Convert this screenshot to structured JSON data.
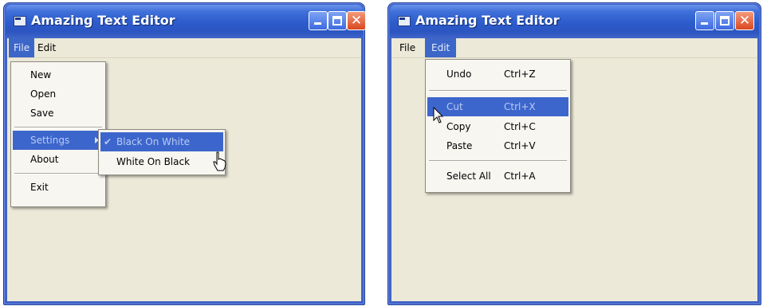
{
  "left_window": {
    "title": "Amazing Text Editor",
    "menubar": {
      "file": "File",
      "edit": "Edit"
    },
    "file_menu": {
      "items": [
        "New",
        "Open",
        "Save",
        "Settings",
        "About",
        "Exit"
      ],
      "highlighted": "Settings"
    },
    "settings_submenu": {
      "items": [
        "Black On White",
        "White On Black"
      ],
      "checked": "Black On White",
      "highlighted": "Black On White"
    }
  },
  "right_window": {
    "title": "Amazing Text Editor",
    "menubar": {
      "file": "File",
      "edit": "Edit"
    },
    "edit_menu": {
      "items": [
        {
          "label": "Undo",
          "shortcut": "Ctrl+Z"
        },
        {
          "label": "Cut",
          "shortcut": "Ctrl+X"
        },
        {
          "label": "Copy",
          "shortcut": "Ctrl+C"
        },
        {
          "label": "Paste",
          "shortcut": "Ctrl+V"
        },
        {
          "label": "Select All",
          "shortcut": "Ctrl+A"
        }
      ],
      "highlighted": "Cut"
    }
  },
  "colors": {
    "title_bar": "#2d5ccd",
    "menu_highlight": "#3d66cc",
    "client_area": "#ece9d8",
    "close_button": "#d9481f"
  }
}
